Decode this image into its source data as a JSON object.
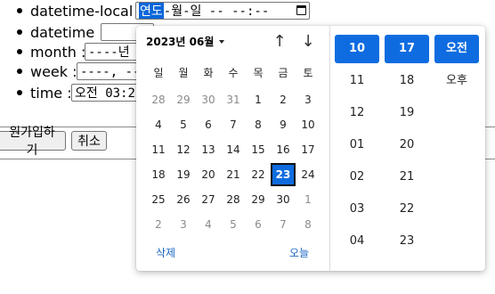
{
  "form": {
    "rows": [
      {
        "label": "datetime-local :",
        "value_hl": "연도",
        "value_rest": "-월-일  -- --:--"
      },
      {
        "label": "datetime :",
        "value": ""
      },
      {
        "label": "month :",
        "value": "----년 --"
      },
      {
        "label": "week :",
        "value": "----, --번"
      },
      {
        "label": "time :",
        "value": "오전 03:2"
      }
    ],
    "signup_label": "원가입하기",
    "cancel_label": "취소"
  },
  "picker": {
    "month_title": "2023년 06월",
    "up_arrow": "↑",
    "down_arrow": "↓",
    "weekdays": [
      "일",
      "월",
      "화",
      "수",
      "목",
      "금",
      "토"
    ],
    "weeks": [
      [
        {
          "d": "28",
          "m": true
        },
        {
          "d": "29",
          "m": true
        },
        {
          "d": "30",
          "m": true
        },
        {
          "d": "31",
          "m": true
        },
        {
          "d": "1"
        },
        {
          "d": "2"
        },
        {
          "d": "3"
        }
      ],
      [
        {
          "d": "4"
        },
        {
          "d": "5"
        },
        {
          "d": "6"
        },
        {
          "d": "7"
        },
        {
          "d": "8"
        },
        {
          "d": "9"
        },
        {
          "d": "10"
        }
      ],
      [
        {
          "d": "11"
        },
        {
          "d": "12"
        },
        {
          "d": "13"
        },
        {
          "d": "14"
        },
        {
          "d": "15"
        },
        {
          "d": "16"
        },
        {
          "d": "17"
        }
      ],
      [
        {
          "d": "18"
        },
        {
          "d": "19"
        },
        {
          "d": "20"
        },
        {
          "d": "21"
        },
        {
          "d": "22"
        },
        {
          "d": "23",
          "s": true
        },
        {
          "d": "24"
        }
      ],
      [
        {
          "d": "25"
        },
        {
          "d": "26"
        },
        {
          "d": "27"
        },
        {
          "d": "28"
        },
        {
          "d": "29"
        },
        {
          "d": "30"
        },
        {
          "d": "1",
          "m": true
        }
      ],
      [
        {
          "d": "2",
          "m": true
        },
        {
          "d": "3",
          "m": true
        },
        {
          "d": "4",
          "m": true
        },
        {
          "d": "5",
          "m": true
        },
        {
          "d": "6",
          "m": true
        },
        {
          "d": "7",
          "m": true
        },
        {
          "d": "8",
          "m": true
        }
      ]
    ],
    "clear_label": "삭제",
    "today_label": "오늘",
    "hours": [
      "10",
      "11",
      "12",
      "01",
      "02",
      "03",
      "04"
    ],
    "minutes": [
      "17",
      "18",
      "19",
      "20",
      "21",
      "22",
      "23"
    ],
    "ampm": [
      "오전",
      "오후"
    ],
    "selected": {
      "hour": "10",
      "minute": "17",
      "ampm": "오전",
      "day": "23"
    },
    "accent_color": "#0f6ce0"
  }
}
